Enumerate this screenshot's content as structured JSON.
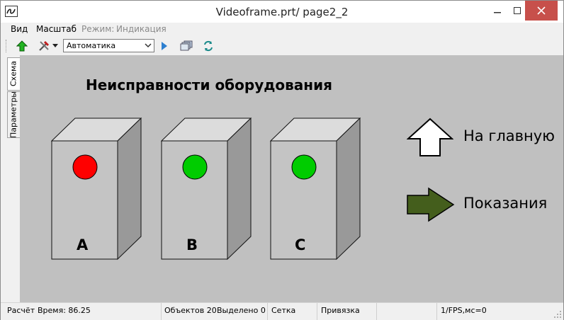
{
  "window": {
    "title": "Videoframe.prt/ page2_2"
  },
  "menu": {
    "items": [
      "Вид",
      "Масштаб"
    ],
    "mode_label": "Режим:",
    "mode_value": "Индикация"
  },
  "toolbar": {
    "combo_value": "Автоматика",
    "icons": [
      "up-arrow-icon",
      "tools-icon",
      "play-icon",
      "windows-icon",
      "refresh-icon"
    ]
  },
  "side_tabs": [
    "Схема",
    "Параметры"
  ],
  "canvas": {
    "title": "Неисправности оборудования",
    "devices": [
      {
        "label": "A",
        "status": "fault",
        "indicator_color": "#ff0000"
      },
      {
        "label": "B",
        "status": "ok",
        "indicator_color": "#00cc00"
      },
      {
        "label": "C",
        "status": "ok",
        "indicator_color": "#00cc00"
      }
    ],
    "nav": {
      "home_label": "На главную",
      "readings_label": "Показания"
    }
  },
  "statusbar": {
    "calc": "Расчёт",
    "time": "Время: 86.25",
    "objects": "Объектов 20",
    "selected": "Выделено 0",
    "grid": "Сетка",
    "snap": "Привязка",
    "fps": "1/FPS,мс=0"
  },
  "colors": {
    "canvas_bg": "#c0c0c0",
    "fault": "#ff0000",
    "ok": "#00cc00",
    "readings_arrow": "#445e1c"
  }
}
